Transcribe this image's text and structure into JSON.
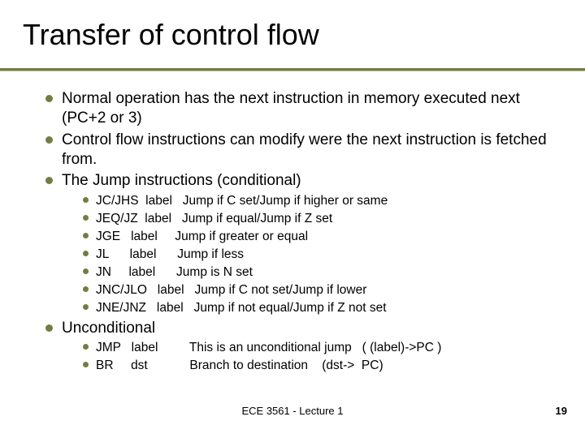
{
  "title": "Transfer of control flow",
  "bullets": {
    "p1": "Normal operation has the next instruction in memory executed next (PC+2 or 3)",
    "p2": "Control flow instructions can modify were the next instruction is fetched from.",
    "p3": "The Jump instructions (conditional)",
    "p3sub": {
      "a": "JC/JHS  label   Jump if C set/Jump if higher or same",
      "b": "JEQ/JZ  label   Jump if equal/Jump if Z set",
      "c": "JGE   label     Jump if greater or equal",
      "d": "JL      label      Jump if less",
      "e": "JN     label      Jump is N set",
      "f": "JNC/JLO   label   Jump if C not set/Jump if lower",
      "g": "JNE/JNZ   label   Jump if not equal/Jump if Z not set"
    },
    "p4": "Unconditional",
    "p4sub": {
      "a": "JMP   label         This is an unconditional jump   ( (label)->PC )",
      "b": "BR     dst            Branch to destination    (dst->  PC)"
    }
  },
  "footer": "ECE 3561 - Lecture 1",
  "page": "19"
}
